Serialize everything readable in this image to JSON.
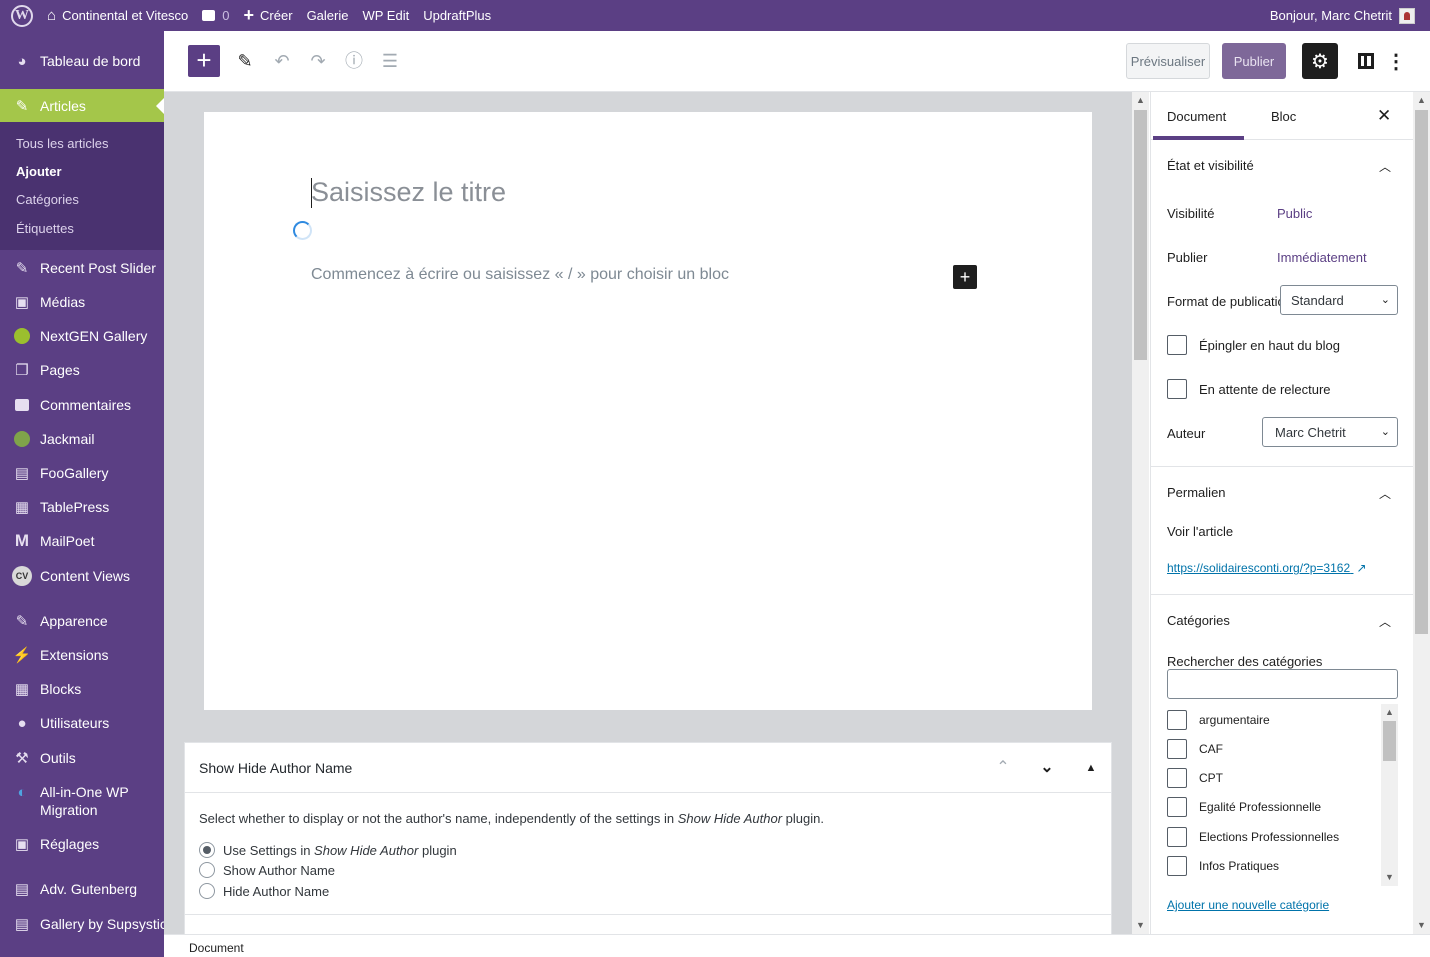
{
  "admin_bar": {
    "site_name": "Continental et Vitesco",
    "comments_count": "0",
    "new_label": "Créer",
    "items": [
      "Galerie",
      "WP Edit",
      "UpdraftPlus"
    ],
    "greeting": "Bonjour, Marc Chetrit"
  },
  "sidebar": {
    "dashboard": "Tableau de bord",
    "articles": "Articles",
    "submenu": [
      "Tous les articles",
      "Ajouter",
      "Catégories",
      "Étiquettes"
    ],
    "items": [
      "Recent Post Slider",
      "Médias",
      "NextGEN Gallery",
      "Pages",
      "Commentaires",
      "Jackmail",
      "FooGallery",
      "TablePress",
      "MailPoet",
      "Content Views"
    ],
    "items2": [
      "Apparence",
      "Extensions",
      "Blocks",
      "Utilisateurs",
      "Outils",
      "All-in-One WP Migration",
      "Réglages"
    ],
    "items3": [
      "Adv. Gutenberg",
      "Gallery by Supsystic"
    ],
    "all_in_one_line1": "All-in-One WP",
    "all_in_one_line2": "Migration",
    "cv_icon": "CV",
    "mailpoet_icon": "M"
  },
  "toolbar": {
    "preview_label": "Prévisualiser",
    "publish_label": "Publier"
  },
  "editor": {
    "title_placeholder": "Saisissez le titre",
    "block_placeholder": "Commencez à écrire ou saisissez « / » pour choisir un bloc"
  },
  "metabox": {
    "title": "Show Hide Author Name",
    "desc_before": "Select whether to display or not the author's name, independently of the settings in ",
    "desc_em": "Show Hide Author",
    "desc_after": " plugin.",
    "opt1_before": "Use Settings in ",
    "opt1_em": "Show Hide Author",
    "opt1_after": " plugin",
    "opt2": "Show Author Name",
    "opt3": "Hide Author Name"
  },
  "settings": {
    "tab_document": "Document",
    "tab_block": "Bloc",
    "status_title": "État et visibilité",
    "visibility_label": "Visibilité",
    "visibility_value": "Public",
    "publish_label": "Publier",
    "publish_value": "Immédiatement",
    "format_label": "Format de publication",
    "format_value": "Standard",
    "sticky_label": "Épingler en haut du blog",
    "pending_label": "En attente de relecture",
    "author_label": "Auteur",
    "author_value": "Marc Chetrit",
    "permalink_title": "Permalien",
    "view_article": "Voir l'article",
    "permalink_url": "https://solidairesconti.org/?p=3162",
    "categories_title": "Catégories",
    "search_categories": "Rechercher des catégories",
    "categories": [
      "argumentaire",
      "CAF",
      "CPT",
      "Egalité Professionnelle",
      "Elections Professionnelles",
      "Infos Pratiques"
    ],
    "add_category": "Ajouter une nouvelle catégorie"
  },
  "footer": {
    "breadcrumb": "Document"
  },
  "colors": {
    "admin_purple": "#5b3f84",
    "active_green": "#a4c64a",
    "link_blue": "#0073aa"
  }
}
